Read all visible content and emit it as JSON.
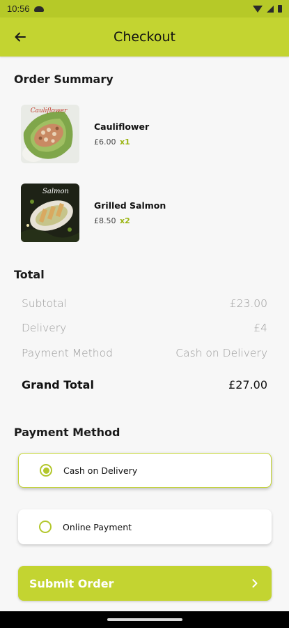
{
  "status_bar": {
    "time": "10:56"
  },
  "app_bar": {
    "title": "Checkout"
  },
  "order_summary": {
    "heading": "Order Summary",
    "items": [
      {
        "name": "Cauliflower",
        "price": "£6.00",
        "qty": "x1",
        "image_text": "Cauliflower"
      },
      {
        "name": "Grilled Salmon",
        "price": "£8.50",
        "qty": "x2",
        "image_text": "Salmon"
      }
    ]
  },
  "total": {
    "heading": "Total",
    "rows": [
      {
        "label": "Subtotal",
        "value": "£23.00"
      },
      {
        "label": "Delivery",
        "value": "£4"
      },
      {
        "label": "Payment Method",
        "value": "Cash on Delivery"
      }
    ],
    "grand": {
      "label": "Grand Total",
      "value": "£27.00"
    }
  },
  "payment": {
    "heading": "Payment Method",
    "options": [
      {
        "label": "Cash on Delivery",
        "selected": true
      },
      {
        "label": "Online Payment",
        "selected": false
      }
    ]
  },
  "submit": {
    "label": "Submit Order"
  },
  "colors": {
    "accent": "#c3d431",
    "status_bar": "#b6c928",
    "qty_green": "#9bb514",
    "background": "#f7f7f7"
  }
}
